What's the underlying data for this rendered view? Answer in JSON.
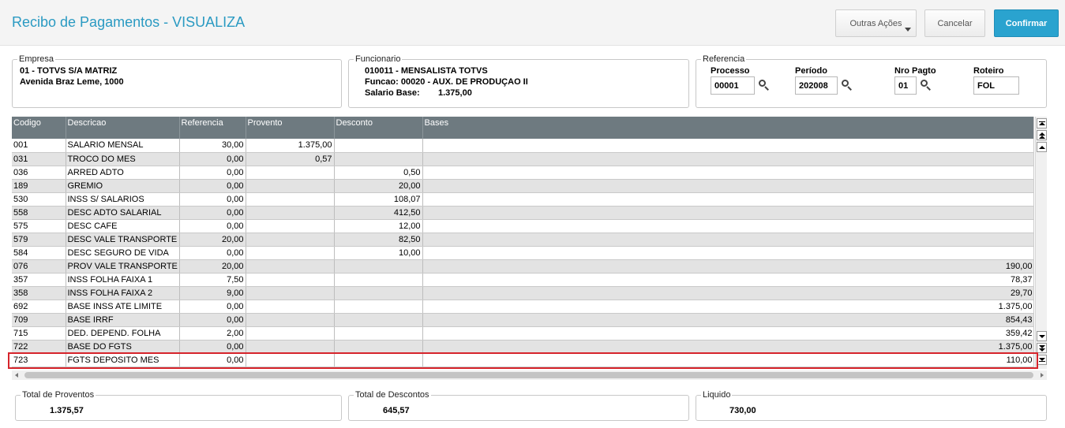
{
  "header": {
    "title": "Recibo de Pagamentos - VISUALIZA",
    "buttons": {
      "outras": "Outras Ações",
      "cancelar": "Cancelar",
      "confirmar": "Confirmar"
    }
  },
  "empresa": {
    "legend": "Empresa",
    "line1": "01 - TOTVS S/A MATRIZ",
    "line2": "Avenida Braz Leme, 1000"
  },
  "funcionario": {
    "legend": "Funcionario",
    "line1": "010011 - MENSALISTA TOTVS",
    "line2": "Funcao: 00020 - AUX. DE PRODUÇAO II",
    "salario_label": "Salario Base:",
    "salario_value": "1.375,00"
  },
  "referencia": {
    "legend": "Referencia",
    "processo": {
      "label": "Processo",
      "value": "00001"
    },
    "periodo": {
      "label": "Período",
      "value": "202008"
    },
    "nro_pagto": {
      "label": "Nro Pagto",
      "value": "01"
    },
    "roteiro": {
      "label": "Roteiro",
      "value": "FOL"
    }
  },
  "grid": {
    "columns": [
      "Codigo",
      "Descricao",
      "Referencia",
      "Provento",
      "Desconto",
      "Bases"
    ],
    "rows": [
      [
        "001",
        "SALARIO MENSAL",
        "30,00",
        "1.375,00",
        "",
        ""
      ],
      [
        "031",
        "TROCO DO MES",
        "0,00",
        "0,57",
        "",
        ""
      ],
      [
        "036",
        "ARRED ADTO",
        "0,00",
        "",
        "0,50",
        ""
      ],
      [
        "189",
        "GREMIO",
        "0,00",
        "",
        "20,00",
        ""
      ],
      [
        "530",
        "INSS S/ SALARIOS",
        "0,00",
        "",
        "108,07",
        ""
      ],
      [
        "558",
        "DESC ADTO SALARIAL",
        "0,00",
        "",
        "412,50",
        ""
      ],
      [
        "575",
        "DESC CAFE",
        "0,00",
        "",
        "12,00",
        ""
      ],
      [
        "579",
        "DESC VALE TRANSPORTE",
        "20,00",
        "",
        "82,50",
        ""
      ],
      [
        "584",
        "DESC SEGURO DE VIDA",
        "0,00",
        "",
        "10,00",
        ""
      ],
      [
        "076",
        "PROV VALE TRANSPORTE",
        "20,00",
        "",
        "",
        "190,00"
      ],
      [
        "357",
        "INSS FOLHA FAIXA 1",
        "7,50",
        "",
        "",
        "78,37"
      ],
      [
        "358",
        "INSS FOLHA FAIXA 2",
        "9,00",
        "",
        "",
        "29,70"
      ],
      [
        "692",
        "BASE INSS ATE LIMITE",
        "0,00",
        "",
        "",
        "1.375,00"
      ],
      [
        "709",
        "BASE IRRF",
        "0,00",
        "",
        "",
        "854,43"
      ],
      [
        "715",
        "DED. DEPEND. FOLHA",
        "2,00",
        "",
        "",
        "359,42"
      ],
      [
        "722",
        "BASE DO FGTS",
        "0,00",
        "",
        "",
        "1.375,00"
      ],
      [
        "723",
        "FGTS DEPOSITO MES",
        "0,00",
        "",
        "",
        "110,00"
      ]
    ]
  },
  "totals": {
    "proventos": {
      "label": "Total de Proventos",
      "value": "1.375,57"
    },
    "descontos": {
      "label": "Total de Descontos",
      "value": "645,57"
    },
    "liquido": {
      "label": "Liquido",
      "value": "730,00"
    }
  },
  "colors": {
    "accent": "#2aa3cf",
    "title": "#2a9ac2",
    "grid_header": "#6e7a80",
    "highlight": "#d6242b"
  }
}
